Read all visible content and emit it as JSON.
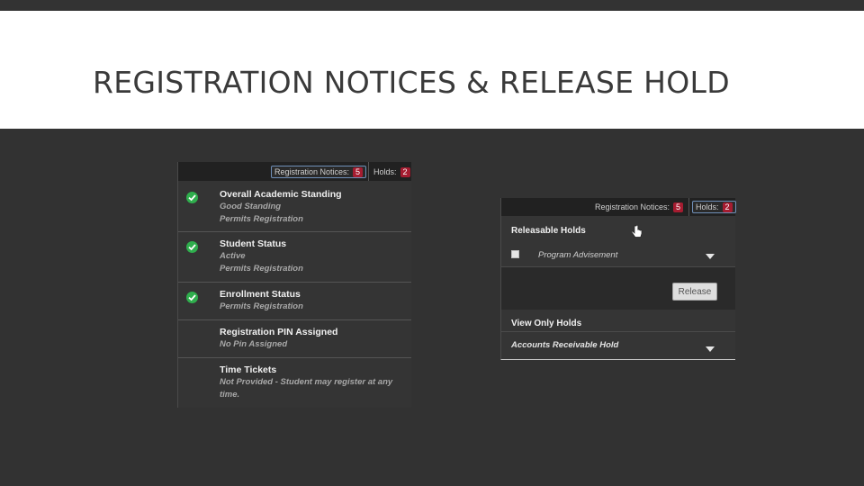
{
  "slide": {
    "title": "REGISTRATION NOTICES & RELEASE HOLD"
  },
  "left_panel": {
    "header": {
      "notices_label": "Registration Notices:",
      "notices_count": "5",
      "holds_label": "Holds:",
      "holds_count": "2"
    },
    "notices": [
      {
        "title": "Overall Academic Standing",
        "line1": "Good Standing",
        "line2": "Permits Registration",
        "checked": true
      },
      {
        "title": "Student Status",
        "line1": "Active",
        "line2": "Permits Registration",
        "checked": true
      },
      {
        "title": "Enrollment Status",
        "line1": "Permits Registration",
        "checked": true
      },
      {
        "title": "Registration PIN Assigned",
        "line1": "No Pin Assigned",
        "checked": false
      },
      {
        "title": "Time Tickets",
        "line1": "Not Provided - Student may register at any",
        "line2": "time.",
        "checked": false
      }
    ]
  },
  "right_panel": {
    "header": {
      "notices_label": "Registration Notices:",
      "notices_count": "5",
      "holds_label": "Holds:",
      "holds_count": "2"
    },
    "releasable_title": "Releasable Holds",
    "releasable_item": "Program Advisement",
    "release_button": "Release",
    "view_only_title": "View Only Holds",
    "view_only_item": "Accounts Receivable Hold"
  },
  "colors": {
    "badge": "#a51c30",
    "check": "#2fae4d",
    "active_outline": "#6f8fb8"
  }
}
